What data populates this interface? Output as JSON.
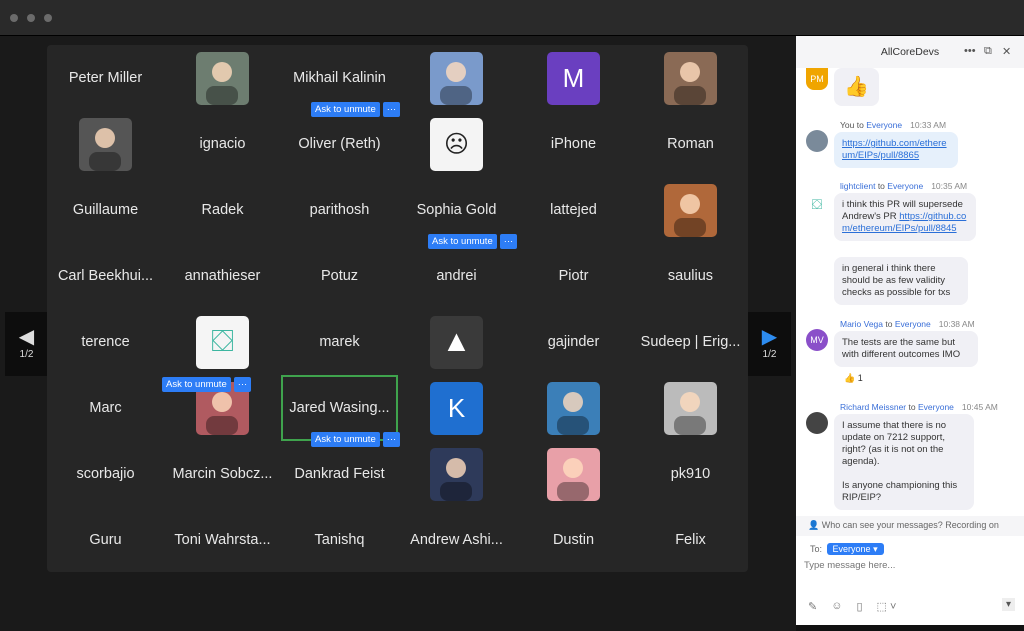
{
  "window": {
    "controls": [
      "close",
      "minimize",
      "zoom"
    ]
  },
  "grid": {
    "rows": [
      [
        {
          "name": "Peter Miller"
        },
        {
          "avatar": "photo",
          "color": "#6d7d70"
        },
        {
          "name": "Mikhail Kalinin"
        },
        {
          "avatar": "photo",
          "color": "#7a9acb"
        },
        {
          "avatar": "letter",
          "letter": "M",
          "color": "#6a3fc0"
        },
        {
          "avatar": "photo",
          "color": "#8a6a55"
        }
      ],
      [
        {
          "avatar": "photo",
          "color": "#555"
        },
        {
          "name": "ignacio"
        },
        {
          "name": "Oliver (Reth)",
          "badge": true
        },
        {
          "avatar": "drawing",
          "color": "#f4f4f4"
        },
        {
          "name": "iPhone"
        },
        {
          "name": "Roman"
        }
      ],
      [
        {
          "name": "Guillaume"
        },
        {
          "name": "Radek"
        },
        {
          "name": "parithosh"
        },
        {
          "name": "Sophia Gold"
        },
        {
          "name": "lattejed"
        },
        {
          "avatar": "photo",
          "color": "#b0683a"
        }
      ],
      [
        {
          "name": "Carl Beekhui..."
        },
        {
          "name": "annathieser"
        },
        {
          "name": "Potuz"
        },
        {
          "name": "andrei",
          "badge": true
        },
        {
          "name": "Piotr"
        },
        {
          "name": "saulius"
        }
      ],
      [
        {
          "name": "terence"
        },
        {
          "avatar": "lightclient",
          "color": "#f5f5f5"
        },
        {
          "name": "marek"
        },
        {
          "avatar": "triangle",
          "color": "#3a3a3a"
        },
        {
          "name": "gajinder"
        },
        {
          "name": "Sudeep | Erig..."
        }
      ],
      [
        {
          "name": "Marc"
        },
        {
          "avatar": "photo",
          "color": "#b05a60",
          "badge": true
        },
        {
          "name": "Jared Wasing...",
          "selected": true
        },
        {
          "avatar": "letter",
          "letter": "K",
          "color": "#1f6fd0"
        },
        {
          "avatar": "photo",
          "color": "#3b7fb8"
        },
        {
          "avatar": "photo",
          "color": "#bbb"
        }
      ],
      [
        {
          "name": "scorbajio"
        },
        {
          "name": "Marcin Sobcz..."
        },
        {
          "name": "Dankrad Feist",
          "badge": true
        },
        {
          "avatar": "photo",
          "color": "#2e3a5a"
        },
        {
          "avatar": "photo",
          "color": "#e8a0a8"
        },
        {
          "name": "pk910"
        }
      ],
      [
        {
          "name": "Guru"
        },
        {
          "name": "Toni Wahrsta..."
        },
        {
          "name": "Tanishq"
        },
        {
          "name": "Andrew Ashi..."
        },
        {
          "name": "Dustin"
        },
        {
          "name": "Felix"
        }
      ]
    ],
    "ask_to_unmute": "Ask to unmute",
    "more": "···"
  },
  "nav": {
    "prev_page": "1/2",
    "next_page": "1/2",
    "accent": "#2d8cf0"
  },
  "chat": {
    "title": "AllCoreDevs",
    "messages": [
      {
        "avatar": "PM",
        "avatar_color": "#f0a500",
        "text": "👍"
      },
      {
        "sender": "You",
        "to": "Everyone",
        "time": "10:33 AM",
        "link": "https://github.com/ethereum/EIPs/pull/8865"
      },
      {
        "sender": "lightclient",
        "to": "Everyone",
        "time": "10:35 AM",
        "text": "i think this PR will supersede Andrew's PR ",
        "link": "https://github.com/ethereum/EIPs/pull/8845"
      },
      {
        "text": "in general i think there should be as few validity checks as possible for txs"
      },
      {
        "sender": "Mario Vega",
        "to": "Everyone",
        "time": "10:38 AM",
        "avatar": "MV",
        "avatar_color": "#8a4fc9",
        "text": "The tests are the same but with different outcomes IMO",
        "reaction": "👍",
        "reaction_count": "1"
      },
      {
        "sender": "Richard Meissner",
        "to": "Everyone",
        "time": "10:45 AM",
        "text": "I assume that there is no update on 7212 support, right? (as it is not on the agenda).",
        "text2": "Is anyone championing this RIP/EIP?"
      }
    ],
    "to_word": "to",
    "privacy": "Who can see your messages? Recording on",
    "to_label": "To:",
    "recipient": "Everyone",
    "placeholder": "Type message here..."
  }
}
